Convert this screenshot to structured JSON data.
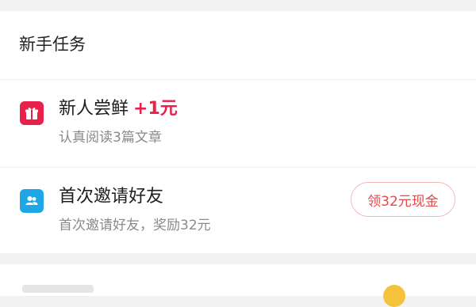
{
  "section": {
    "title": "新手任务"
  },
  "tasks": [
    {
      "icon": "gift-icon",
      "icon_color": "#e8204a",
      "title": "新人尝鲜",
      "reward": "+1元",
      "subtitle": "认真阅读3篇文章"
    },
    {
      "icon": "users-icon",
      "icon_color": "#1ea7e4",
      "title": "首次邀请好友",
      "subtitle": "首次邀请好友，奖励32元",
      "button": "领32元现金"
    }
  ],
  "colors": {
    "accent": "#e8204a",
    "button_border": "#f2b7b7",
    "background": "#f2f2f2"
  }
}
